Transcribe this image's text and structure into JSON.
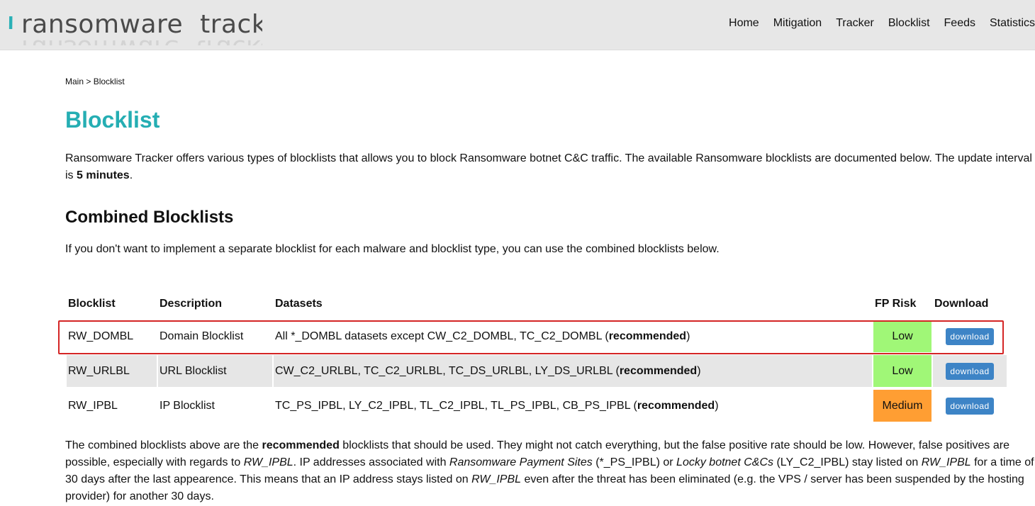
{
  "logo": {
    "slashes": "\\\\",
    "text": "ransomware  tracker"
  },
  "nav": {
    "items": [
      "Home",
      "Mitigation",
      "Tracker",
      "Blocklist",
      "Feeds",
      "Statistics"
    ]
  },
  "breadcrumb": {
    "main": "Main",
    "separator": " > ",
    "current": "Blocklist"
  },
  "page_title": "Blocklist",
  "intro": {
    "text": "Ransomware Tracker offers various types of blocklists that allows you to block Ransomware botnet C&C traffic. The available Ransomware blocklists are documented below. The update interval is ",
    "interval": "5 minutes",
    "suffix": "."
  },
  "section": {
    "title": "Combined Blocklists",
    "description": "If you don't want to implement a separate blocklist for each malware and blocklist type, you can use the combined blocklists below."
  },
  "table": {
    "headers": [
      "Blocklist",
      "Description",
      "Datasets",
      "FP Risk",
      "Download"
    ],
    "rows": [
      {
        "blocklist": "RW_DOMBL",
        "description": "Domain Blocklist",
        "datasets": "All *_DOMBL datasets except CW_C2_DOMBL, TC_C2_DOMBL (",
        "recommended": "recommended",
        "close": ")",
        "risk": "Low",
        "risk_color": "#a0f777",
        "download": "download"
      },
      {
        "blocklist": "RW_URLBL",
        "description": "URL Blocklist",
        "datasets": "CW_C2_URLBL, TC_C2_URLBL, TC_DS_URLBL, LY_DS_URLBL (",
        "recommended": "recommended",
        "close": ")",
        "risk": "Low",
        "risk_color": "#a0f777",
        "download": "download"
      },
      {
        "blocklist": "RW_IPBL",
        "description": "IP Blocklist",
        "datasets": "TC_PS_IPBL, LY_C2_IPBL, TL_C2_IPBL, TL_PS_IPBL, CB_PS_IPBL (",
        "recommended": "recommended",
        "close": ")",
        "risk": "Medium",
        "risk_color": "#ff9e33",
        "download": "download"
      }
    ]
  },
  "footer": {
    "p1": "The combined blocklists above are the ",
    "b1": "recommended",
    "p2": " blocklists that should be used. They might not catch everything, but the false positive rate should be low. However, false positives are possible, especially with regards to ",
    "i1": "RW_IPBL",
    "p3": ". IP addresses associated with ",
    "i2": "Ransomware Payment Sites",
    "p4": " (*_PS_IPBL) or ",
    "i3": "Locky botnet C&Cs",
    "p5": " (LY_C2_IPBL) stay listed on ",
    "i4": "RW_IPBL",
    "p6": " for a time of 30 days after the last appearence. This means that an IP address stays listed on ",
    "i5": "RW_IPBL",
    "p7": " even after the threat has been eliminated (e.g. the VPS / server has been suspended by the hosting provider) for another 30 days."
  },
  "colors": {
    "accent": "#25aeb3",
    "button": "#3d84c6",
    "highlight": "#d42525"
  }
}
